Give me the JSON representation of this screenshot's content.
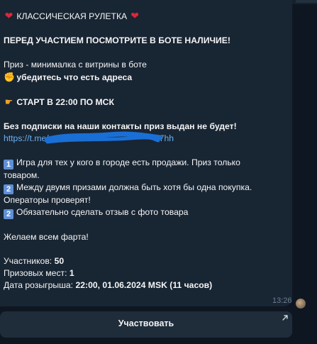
{
  "message": {
    "title": "КЛАССИЧЕСКАЯ РУЛЕТКА",
    "notice": "ПЕРЕД УЧАСТИЕМ ПОСМОТРИТЕ В БОТЕ НАЛИЧИЕ!",
    "prize_line": "Приз - минималка с витрины в боте",
    "address_line": "убедитесь что есть адреса",
    "start_line": "СТАРТ В 22:00 ПО МСК",
    "subscribe_warning": "Без подписки на наши контакты приз выдан не будет!",
    "link_start": "https://t.me/",
    "link_end": "7hh",
    "rules": [
      {
        "num": "1",
        "text": "Игра для тех у кого в городе есть продажи. Приз только",
        "cont": "товаром."
      },
      {
        "num": "2",
        "text": "Между двумя призами должна быть хотя бы одна покупка.",
        "cont": "Операторы проверят!"
      },
      {
        "num": "2",
        "text": "Обязательно сделать отзыв с фото товара"
      }
    ],
    "wish": "Желаем всем фарта!",
    "participants_label": "Участников:",
    "participants_value": "50",
    "prizes_label": "Призовых мест:",
    "prizes_value": "1",
    "date_label": "Дата розыгрыша:",
    "date_value": "22:00, 01.06.2024 MSK (11 часов)",
    "time": "13:26"
  },
  "button": {
    "label": "Участвовать"
  },
  "icons": {
    "heart": "red-heart-icon",
    "muscle": "flexed-biceps-icon",
    "point": "pointing-hand-icon",
    "arrow": "external-arrow-icon"
  },
  "colors": {
    "background": "#0e1621",
    "bubble": "#182533",
    "link": "#6ab2f2",
    "button": "#1f2d3b",
    "number_box": "#5f8fd6"
  }
}
